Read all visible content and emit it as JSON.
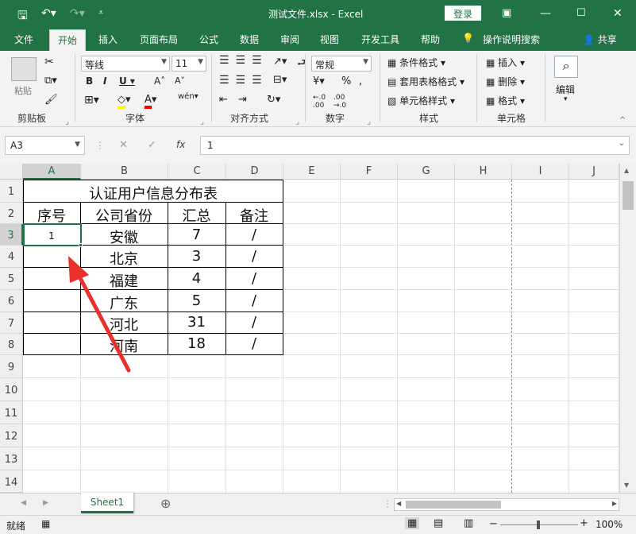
{
  "window": {
    "title": "测试文件.xlsx  -  Excel",
    "login_label": "登录"
  },
  "tabs": [
    "文件",
    "开始",
    "插入",
    "页面布局",
    "公式",
    "数据",
    "审阅",
    "视图",
    "开发工具",
    "帮助"
  ],
  "tell_me": "操作说明搜索",
  "share": "共享",
  "ribbon": {
    "clipboard": {
      "paste": "粘贴",
      "label": "剪贴板"
    },
    "font": {
      "name": "等线",
      "size": "11",
      "label": "字体"
    },
    "alignment": {
      "label": "对齐方式"
    },
    "number": {
      "format": "常规",
      "label": "数字"
    },
    "styles": {
      "cond": "条件格式",
      "table": "套用表格格式",
      "cell": "单元格样式",
      "label": "样式"
    },
    "cells": {
      "insert": "插入",
      "delete": "删除",
      "format": "格式",
      "label": "单元格"
    },
    "editing": {
      "label": "编辑"
    }
  },
  "formula_bar": {
    "name_box": "A3",
    "fx_label": "fx",
    "content": "1"
  },
  "columns": [
    "A",
    "B",
    "C",
    "D",
    "E",
    "F",
    "G",
    "H",
    "I",
    "J"
  ],
  "rows": [
    "1",
    "2",
    "3",
    "4",
    "5",
    "6",
    "7",
    "8",
    "9",
    "10",
    "11",
    "12",
    "13",
    "14"
  ],
  "table": {
    "title": "认证用户信息分布表",
    "headers": [
      "序号",
      "公司省份",
      "汇总",
      "备注"
    ],
    "rows": [
      [
        "1",
        "安徽",
        "7",
        "/"
      ],
      [
        "",
        "北京",
        "3",
        "/"
      ],
      [
        "",
        "福建",
        "4",
        "/"
      ],
      [
        "",
        "广东",
        "5",
        "/"
      ],
      [
        "",
        "河北",
        "31",
        "/"
      ],
      [
        "",
        "河南",
        "18",
        "/"
      ]
    ]
  },
  "sheet_tab": "Sheet1",
  "status": {
    "ready": "就绪",
    "zoom": "100%"
  },
  "colors": {
    "accent": "#217346",
    "arrow": "#e8312a"
  }
}
